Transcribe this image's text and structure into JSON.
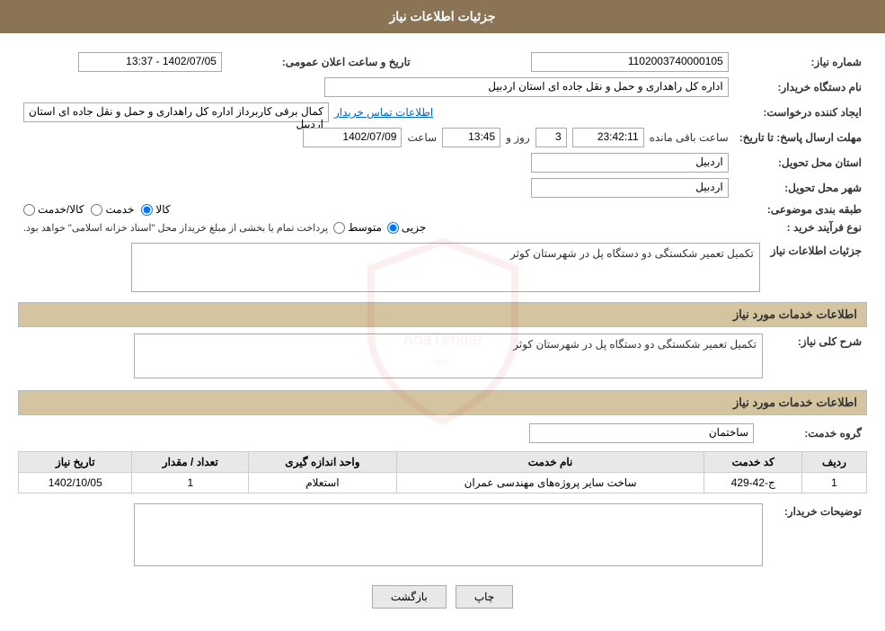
{
  "header": {
    "title": "جزئیات اطلاعات نیاز"
  },
  "sections": {
    "need_info": "جزئیات اطلاعات نیاز",
    "services_info": "اطلاعات خدمات مورد نیاز"
  },
  "fields": {
    "need_number_label": "شماره نیاز:",
    "need_number_value": "1102003740000105",
    "buyer_label": "نام دستگاه خریدار:",
    "buyer_value": "اداره کل راهداری و حمل و نقل جاده ای استان اردبیل",
    "creator_label": "ایجاد کننده درخواست:",
    "creator_value": "کمال برقی کاربرداز اداره کل راهداری و حمل و نقل جاده ای استان اردبیل",
    "contact_link": "اطلاعات تماس خریدار",
    "deadline_label": "مهلت ارسال پاسخ: تا تاریخ:",
    "announcement_date_label": "تاریخ و ساعت اعلان عمومی:",
    "announcement_date_value": "1402/07/05 - 13:37",
    "deadline_date_value": "1402/07/09",
    "deadline_time_value": "13:45",
    "deadline_days_value": "3",
    "deadline_remaining_value": "23:42:11",
    "deadline_days_label": "روز و",
    "deadline_remaining_label": "ساعت باقی مانده",
    "province_label": "استان محل تحویل:",
    "province_value": "اردبیل",
    "city_label": "شهر محل تحویل:",
    "city_value": "اردبیل",
    "category_label": "طبقه بندی موضوعی:",
    "category_goods": "کالا",
    "category_service": "خدمت",
    "category_goods_service": "کالا/خدمت",
    "purchase_type_label": "نوع فرآیند خرید :",
    "purchase_type_partial": "جزیی",
    "purchase_type_medium": "متوسط",
    "purchase_note": "پرداخت تمام یا بخشی از مبلغ خریداز محل \"اسناد خزانه اسلامی\" خواهد بود.",
    "description_label": "شرح کلی نیاز:",
    "description_value": "تکمیل تعمیر شکستگی دو دستگاه پل در شهرستان کوثر",
    "service_group_label": "گروه خدمت:",
    "service_group_value": "ساختمان"
  },
  "table": {
    "headers": [
      "ردیف",
      "کد خدمت",
      "نام خدمت",
      "واحد اندازه گیری",
      "تعداد / مقدار",
      "تاریخ نیاز"
    ],
    "rows": [
      {
        "row": "1",
        "code": "ج-42-429",
        "name": "ساخت سایر پروژه‌های مهندسی عمران",
        "unit": "استعلام",
        "quantity": "1",
        "date": "1402/10/05"
      }
    ]
  },
  "buyer_notes_label": "توضیحات خریدار:",
  "buyer_notes_value": "",
  "buttons": {
    "print": "چاپ",
    "back": "بازگشت"
  }
}
